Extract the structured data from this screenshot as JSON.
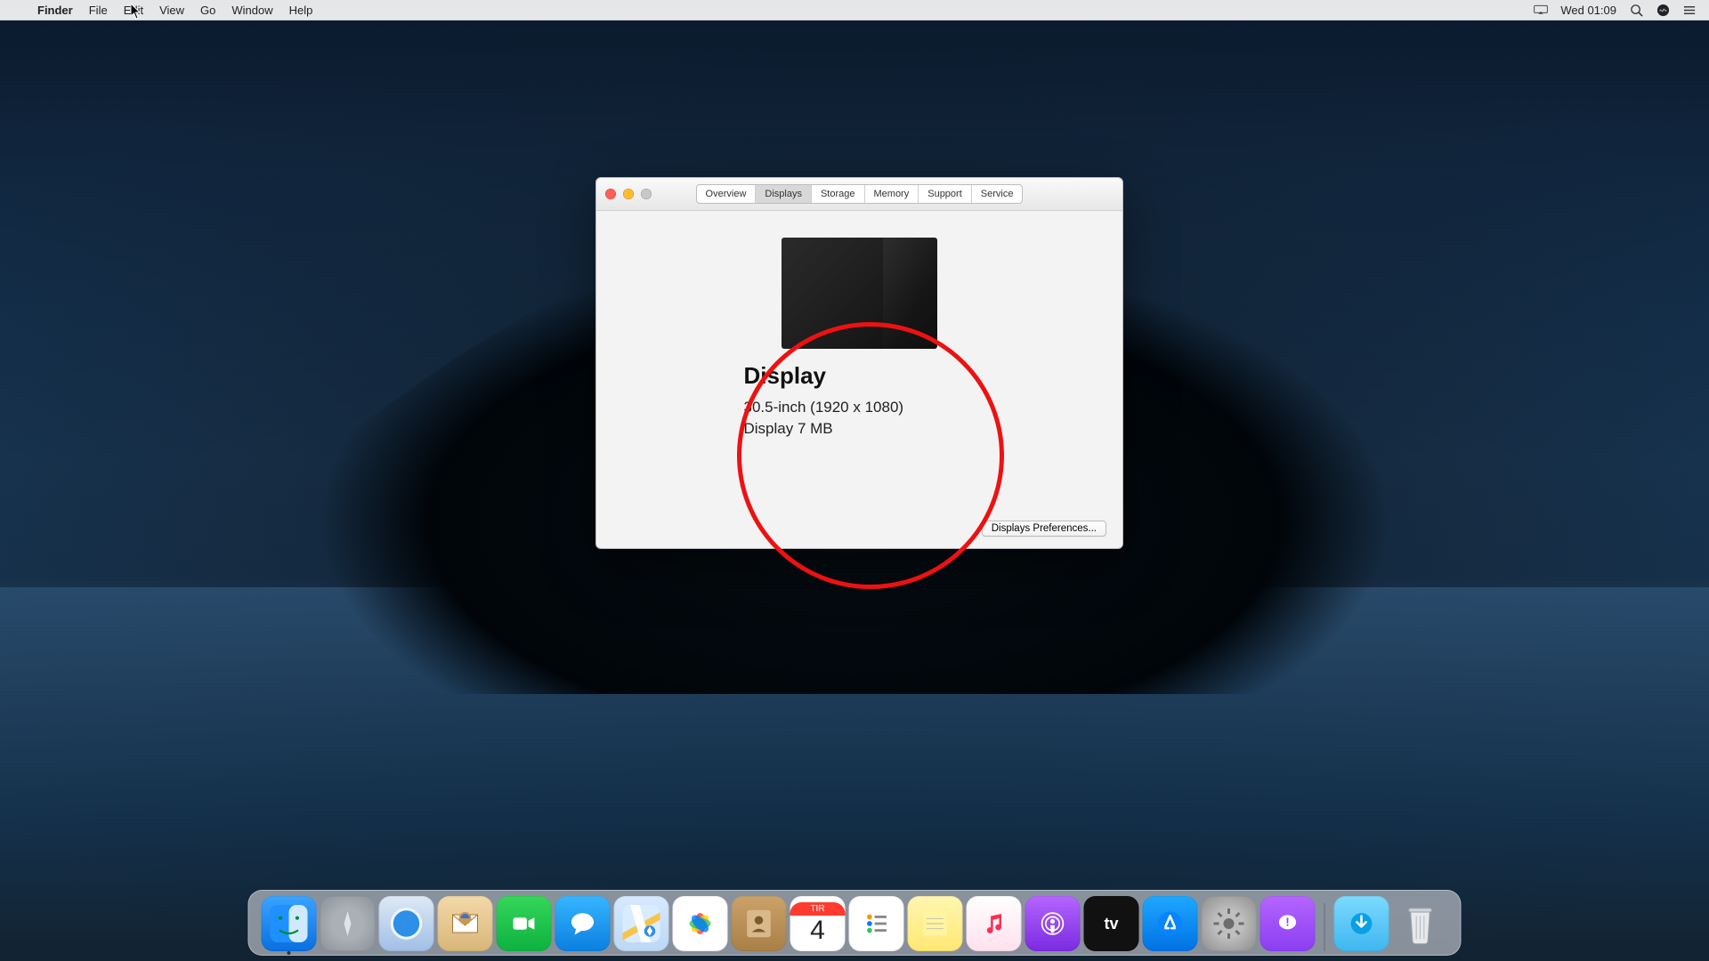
{
  "menubar": {
    "app_name": "Finder",
    "items": [
      "File",
      "Edit",
      "View",
      "Go",
      "Window",
      "Help"
    ],
    "clock": "Wed 01:09"
  },
  "window": {
    "tabs": [
      "Overview",
      "Displays",
      "Storage",
      "Memory",
      "Support",
      "Service"
    ],
    "active_tab_index": 1,
    "display_title": "Display",
    "display_spec": "30.5-inch (1920 x 1080)",
    "display_vram": "Display 7 MB",
    "prefs_button": "Displays Preferences..."
  },
  "dock": {
    "calendar_label": "TIR",
    "calendar_day": "4",
    "apps": [
      "finder",
      "launchpad",
      "safari",
      "mail",
      "facetime",
      "messages",
      "maps",
      "photos",
      "contacts",
      "calendar",
      "reminders",
      "notes",
      "music",
      "podcasts",
      "tv",
      "appstore",
      "settings",
      "feedback"
    ],
    "right_apps": [
      "downloads",
      "trash"
    ]
  },
  "annotation": {
    "color": "#e11"
  }
}
